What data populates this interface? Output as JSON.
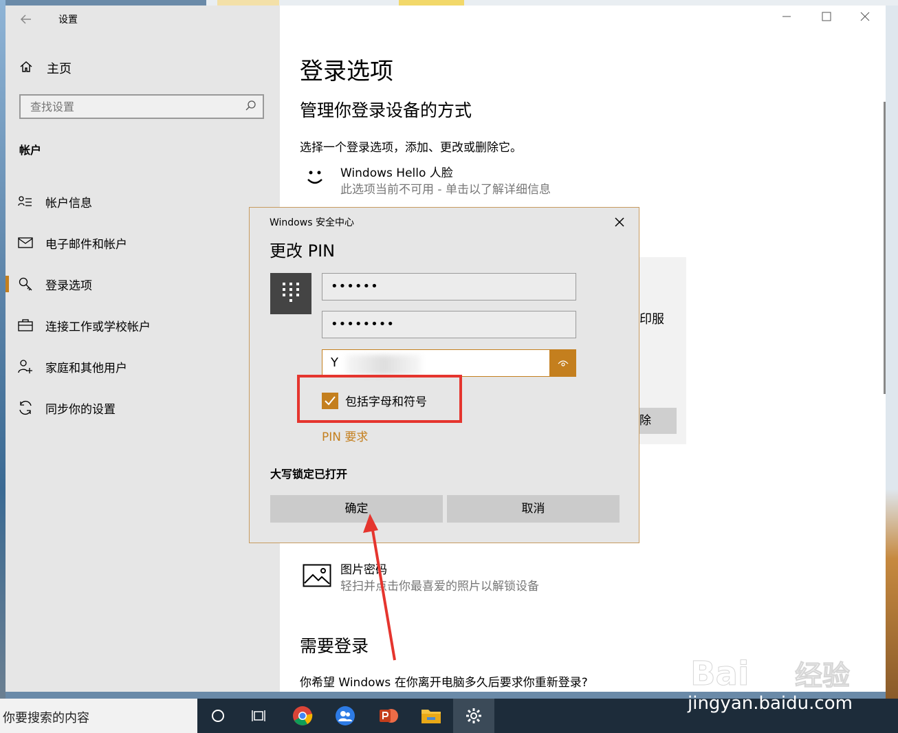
{
  "window": {
    "app_title": "设置"
  },
  "sidebar": {
    "home_label": "主页",
    "search_placeholder": "查找设置",
    "section": "帐户",
    "items": [
      {
        "label": "帐户信息",
        "icon": "account-info-icon"
      },
      {
        "label": "电子邮件和帐户",
        "icon": "mail-icon"
      },
      {
        "label": "登录选项",
        "icon": "key-icon"
      },
      {
        "label": "连接工作或学校帐户",
        "icon": "briefcase-icon"
      },
      {
        "label": "家庭和其他用户",
        "icon": "add-person-icon"
      },
      {
        "label": "同步你的设置",
        "icon": "sync-icon"
      }
    ],
    "active_index": 2
  },
  "main": {
    "title": "登录选项",
    "subtitle": "管理你登录设备的方式",
    "desc": "选择一个登录选项，添加、更改或删除它。",
    "hello_face": {
      "title": "Windows Hello 人脸",
      "sub": "此选项当前不可用 - 单击以了解详细信息"
    },
    "background_card_text": "印服",
    "background_card_button": "除",
    "picture_password": {
      "title": "图片密码",
      "sub": "轻扫并点击你最喜爱的照片以解锁设备"
    },
    "require_signin_title": "需要登录",
    "require_signin_question": "你希望 Windows 在你离开电脑多久后要求你重新登录?"
  },
  "dialog": {
    "app_name": "Windows 安全中心",
    "title": "更改 PIN",
    "fields": [
      "••••••",
      "••••••••",
      "Y"
    ],
    "checkbox_label": "包括字母和符号",
    "checkbox_checked": true,
    "pin_requirements_link": "PIN 要求",
    "caps_lock_warning": "大写锁定已打开",
    "ok_label": "确定",
    "cancel_label": "取消"
  },
  "taskbar": {
    "search_text": "你要搜索的内容"
  },
  "watermark": {
    "brand": "Bai 经验",
    "url": "jingyan.baidu.com"
  },
  "colors": {
    "accent": "#c47f1e",
    "highlight_red": "#e5352e",
    "sidebar_bg": "#e6e6e6"
  }
}
